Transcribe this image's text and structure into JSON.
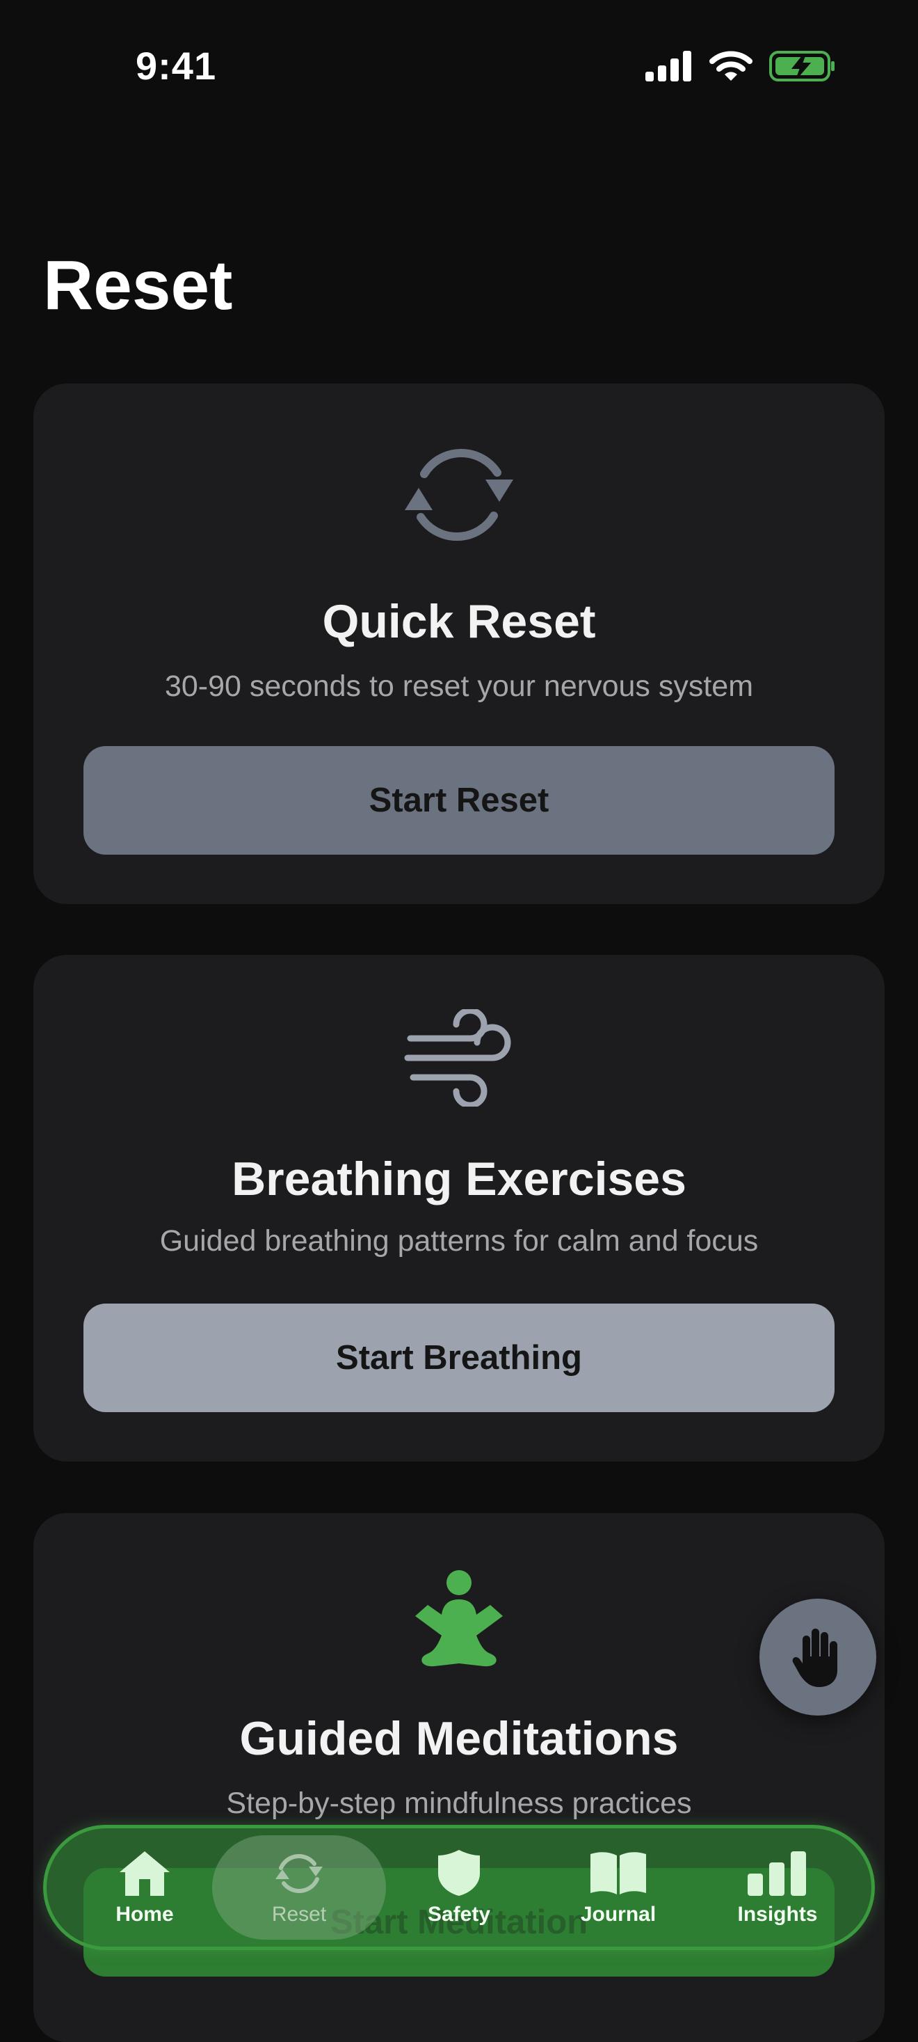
{
  "status_bar": {
    "time": "9:41"
  },
  "page": {
    "title": "Reset"
  },
  "cards": [
    {
      "title": "Quick Reset",
      "subtitle": "30-90 seconds to reset your nervous system",
      "button": "Start Reset",
      "icon": "arrows-cycle-icon",
      "button_color": "#6b7280"
    },
    {
      "title": "Breathing Exercises",
      "subtitle": "Guided breathing patterns for calm and focus",
      "button": "Start Breathing",
      "icon": "wind-icon",
      "button_color": "#9ca3af"
    },
    {
      "title": "Guided Meditations",
      "subtitle": "Step-by-step mindfulness practices",
      "button": "Start Meditation",
      "icon": "meditation-figure-icon",
      "button_color": "#2e7d32"
    }
  ],
  "tabs": [
    {
      "label": "Home",
      "icon": "house-icon"
    },
    {
      "label": "Reset",
      "icon": "arrows-cycle-icon",
      "active": true
    },
    {
      "label": "Safety",
      "icon": "shield-icon"
    },
    {
      "label": "Journal",
      "icon": "open-book-icon"
    },
    {
      "label": "Insights",
      "icon": "bar-chart-icon"
    }
  ],
  "fab": {
    "icon": "raised-hand-icon"
  },
  "colors": {
    "accent_green": "#4caf50",
    "card_bg": "#1c1c1e",
    "background": "#0d0d0d"
  }
}
